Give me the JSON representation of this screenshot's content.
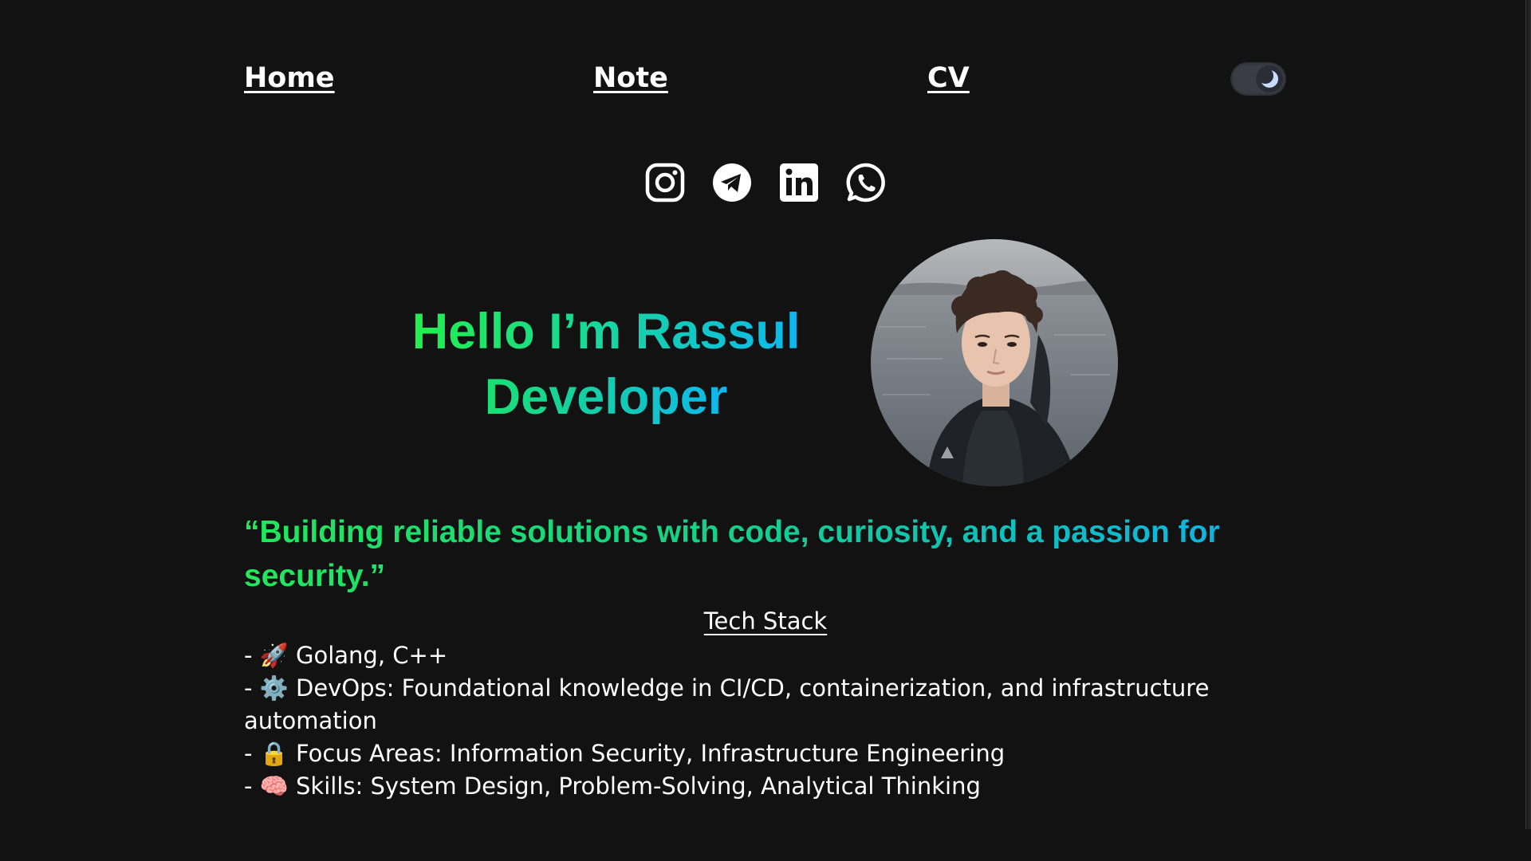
{
  "nav": {
    "home": "Home",
    "note": "Note",
    "cv": "CV"
  },
  "theme_toggle": {
    "icon": "moon-icon",
    "state": "dark"
  },
  "social": [
    "instagram-icon",
    "telegram-icon",
    "linkedin-icon",
    "whatsapp-icon"
  ],
  "hero": {
    "greeting": "Hello I’m",
    "name": "Rassul",
    "role": "Developer"
  },
  "quote": "“Building reliable solutions with code, curiosity, and a passion for security.”",
  "tech_stack": {
    "title": "Tech Stack",
    "items": [
      "- 🚀 Golang, C++",
      "- ⚙️ DevOps: Foundational knowledge in CI/CD, containerization, and infrastructure automation",
      "- 🔒 Focus Areas: Information Security, Infrastructure Engineering",
      "- 🧠 Skills: System Design, Problem-Solving, Analytical Thinking"
    ]
  },
  "colors": {
    "background": "#121212",
    "gradient_start": "#22f04a",
    "gradient_end": "#0bb8f0"
  }
}
